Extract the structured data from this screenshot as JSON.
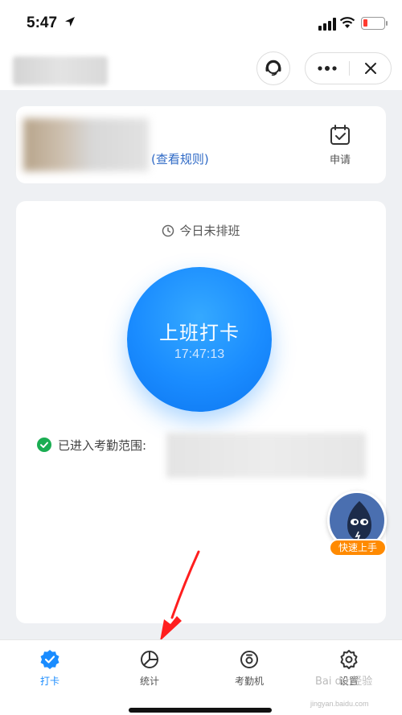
{
  "status_bar": {
    "time": "5:47"
  },
  "header": {},
  "top_card": {
    "rules_link": "(查看规则)",
    "apply_label": "申请"
  },
  "main_card": {
    "schedule_text": "今日未排班",
    "punch_label": "上班打卡",
    "punch_time": "17:47:13",
    "range_text": "已进入考勤范围:"
  },
  "helper": {
    "badge": "快速上手"
  },
  "tabs": [
    {
      "label": "打卡",
      "icon": "check-badge-icon",
      "active": true
    },
    {
      "label": "统计",
      "icon": "pie-chart-icon"
    },
    {
      "label": "考勤机",
      "icon": "attendance-machine-icon"
    },
    {
      "label": "设置",
      "icon": "gear-icon"
    }
  ],
  "watermark": {
    "brand": "Bai du 经验",
    "url": "jingyan.baidu.com"
  },
  "colors": {
    "accent": "#1a8cff",
    "link": "#2f6ac6",
    "success": "#1aad52",
    "badge": "#ff8a00",
    "annotation": "#ff1e1e"
  }
}
